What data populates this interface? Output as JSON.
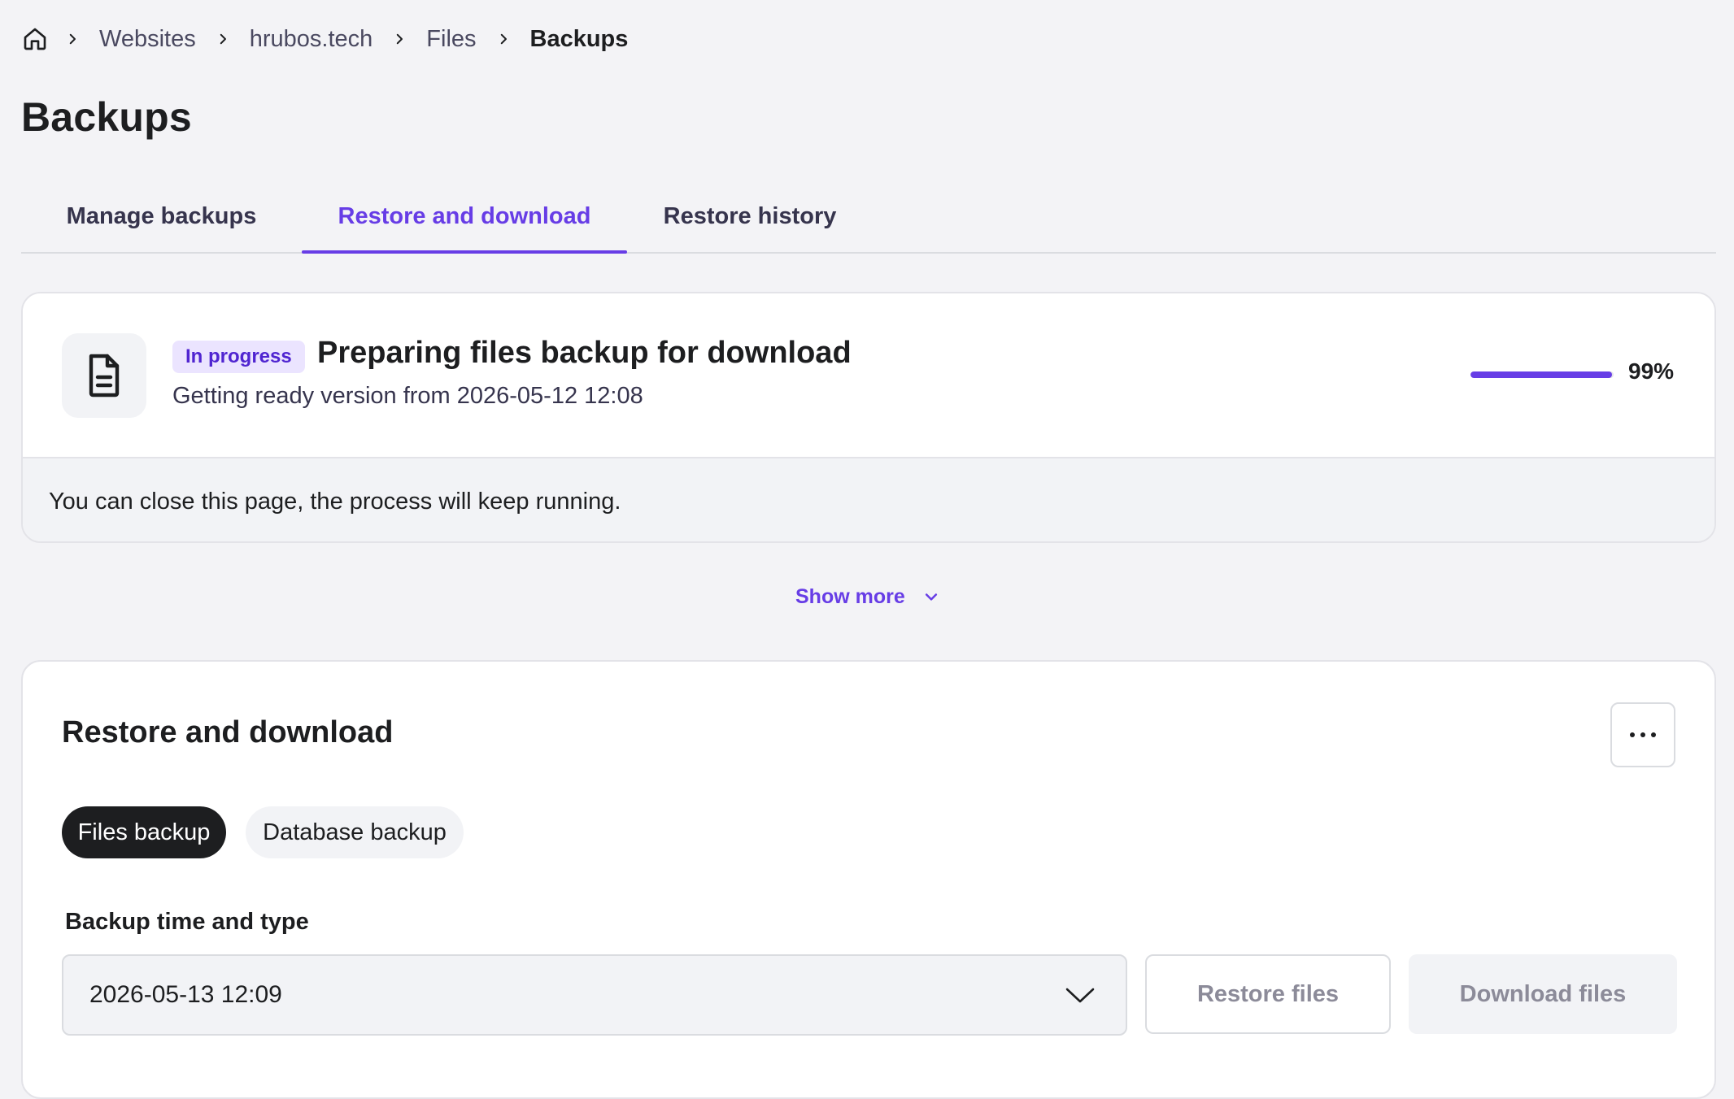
{
  "breadcrumb": {
    "home_icon": "home-icon",
    "separator_icon": "chevron-right-icon",
    "items": [
      "Websites",
      "hrubos.tech",
      "Files"
    ],
    "current": "Backups"
  },
  "page": {
    "title": "Backups"
  },
  "tabs": [
    {
      "label": "Manage backups",
      "active": false
    },
    {
      "label": "Restore and download",
      "active": true
    },
    {
      "label": "Restore history",
      "active": false
    }
  ],
  "progress_card": {
    "icon": "file-document-icon",
    "badge": "In progress",
    "title": "Preparing files backup for download",
    "subtitle": "Getting ready version from 2026-05-12 12:08",
    "percent_label": "99%",
    "percent_value": 99,
    "note": "You can close this page, the process will keep running."
  },
  "show_more": {
    "label": "Show more",
    "icon": "chevron-down-icon"
  },
  "restore": {
    "title": "Restore and download",
    "more_icon": "more-horizontal-icon",
    "chips": [
      {
        "label": "Files backup",
        "selected": true
      },
      {
        "label": "Database backup",
        "selected": false
      }
    ],
    "field_label": "Backup time and type",
    "selected_backup": "2026-05-13 12:09",
    "restore_button": "Restore files",
    "download_button": "Download files"
  },
  "colors": {
    "accent": "#673de6",
    "background": "#f3f3f6",
    "text": "#1d1e20",
    "badge_bg": "#ebe4ff",
    "chip_selected_bg": "#1d1e20"
  }
}
